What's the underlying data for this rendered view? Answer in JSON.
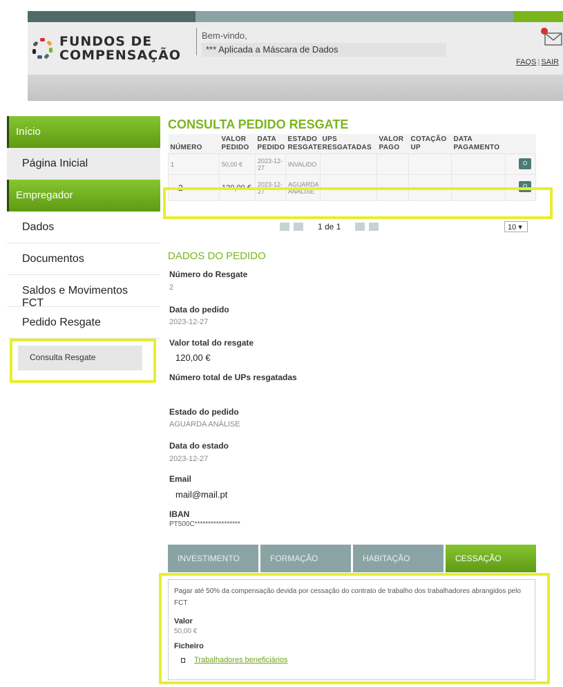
{
  "header": {
    "logo_line1": "FUNDOS DE",
    "logo_line2": "COMPENSAÇÃO",
    "welcome": "Bem-vindo,",
    "mask_notice": "*** Aplicada a Máscara de Dados",
    "faqs": "FAQS",
    "sair": "SAIR",
    "brand_colors": {
      "green": "#7ab51d",
      "teal": "#4f6b68",
      "gray_teal": "#8aa4a6"
    }
  },
  "sidebar": {
    "section1": "Início",
    "item1": "Página Inicial",
    "section2": "Empregador",
    "items": [
      "Dados",
      "Documentos",
      "Saldos e Movimentos FCT",
      "Pedido Resgate"
    ],
    "sub_item": "Consulta Resgate"
  },
  "main": {
    "title": "CONSULTA PEDIDO RESGATE",
    "columns": [
      "NÚMERO",
      "VALOR PEDIDO",
      "DATA PEDIDO",
      "ESTADO RESGATE",
      "UPS RESGATADAS",
      "VALOR PAGO",
      "COTAÇÃO UP",
      "DATA PAGAMENTO"
    ],
    "rows": [
      {
        "numero": "1",
        "valor": "50,00 €",
        "data": "2023-12-27",
        "estado": "INVALIDO",
        "ups": "",
        "pago": "",
        "cotacao": "",
        "pagamento": ""
      },
      {
        "numero": "2",
        "valor": "120,00 €",
        "data": "2023-12-27",
        "estado": "AGUARDA ANÁLISE",
        "ups": "",
        "pago": "",
        "cotacao": "",
        "pagamento": ""
      }
    ],
    "pager_info": "1 de 1",
    "page_size": "10"
  },
  "details": {
    "section": "DADOS DO PEDIDO",
    "numero_label": "Número do Resgate",
    "numero_value": "2",
    "data_label": "Data do pedido",
    "data_value": "2023-12-27",
    "valor_label": "Valor total do resgate",
    "valor_value": "120,00 €",
    "ups_label": "Número total de UPs resgatadas",
    "estado_label": "Estado do pedido",
    "estado_value": "AGUARDA ANÁLISE",
    "data_estado_label": "Data do estado",
    "data_estado_value": "2023-12-27",
    "email_label": "Email",
    "email_value": "mail@mail.pt",
    "iban_label": "IBAN",
    "iban_value": "PT500C*****************"
  },
  "tabs": [
    "INVESTIMENTO",
    "FORMAÇÃO",
    "HABITAÇÃO",
    "CESSAÇÃO"
  ],
  "panel": {
    "description": "Pagar até 50% da compensação devida por cessação do contrato de trabalho dos trabalhadores abrangidos pelo FCT",
    "valor_label": "Valor",
    "valor_value": "50,00 €",
    "ficheiro_label": "Ficheiro",
    "file_link": "Trabalhadores beneficiários"
  }
}
